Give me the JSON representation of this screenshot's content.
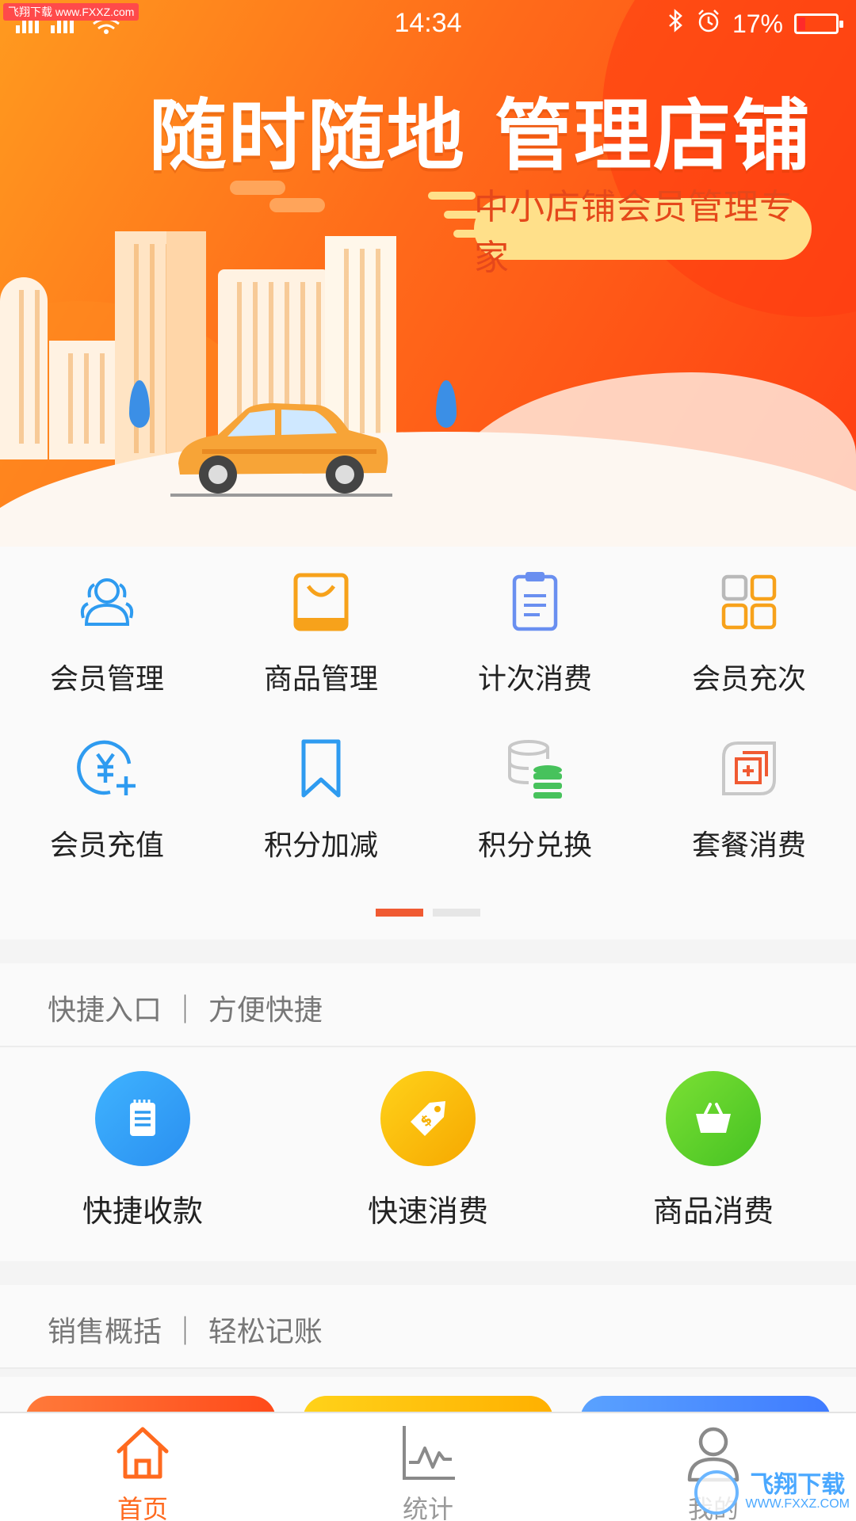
{
  "status_bar": {
    "time": "14:34",
    "battery": "17%",
    "battery_level": 0.17,
    "watermark": "飞翔下载 www.FXXZ.com"
  },
  "banner": {
    "headline": "随时随地 管理店铺",
    "tagline": "中小店铺会员管理专家"
  },
  "menu": {
    "items": [
      {
        "label": "会员管理",
        "icon": "members-icon"
      },
      {
        "label": "商品管理",
        "icon": "shopping-bag-icon"
      },
      {
        "label": "计次消费",
        "icon": "clipboard-icon"
      },
      {
        "label": "会员充次",
        "icon": "grid-icon"
      },
      {
        "label": "会员充值",
        "icon": "yen-add-icon"
      },
      {
        "label": "积分加减",
        "icon": "bookmark-icon"
      },
      {
        "label": "积分兑换",
        "icon": "database-icon"
      },
      {
        "label": "套餐消费",
        "icon": "package-add-icon"
      }
    ],
    "page_count": 2,
    "active_page": 1
  },
  "quick_section": {
    "title": "快捷入口 ｜ 方便快捷",
    "items": [
      {
        "label": "快捷收款",
        "icon": "receipt-icon",
        "color": "#2e9bf0"
      },
      {
        "label": "快速消费",
        "icon": "price-tag-icon",
        "color": "#f7b900"
      },
      {
        "label": "商品消费",
        "icon": "basket-icon",
        "color": "#5bd12a"
      }
    ]
  },
  "sales_section": {
    "title": "销售概括 ｜ 轻松记账"
  },
  "tabbar": {
    "tabs": [
      {
        "label": "首页",
        "icon": "home-icon",
        "active": true
      },
      {
        "label": "统计",
        "icon": "chart-icon",
        "active": false
      },
      {
        "label": "我的",
        "icon": "user-icon",
        "active": false
      }
    ]
  },
  "watermark_bottom": {
    "title": "飞翔下载",
    "sub": "WWW.FXXZ.COM"
  },
  "colors": {
    "accent": "#ff6a1f",
    "active_dot": "#f05a32",
    "icon_blue": "#2e9bf0",
    "icon_orange": "#f7a21b"
  }
}
